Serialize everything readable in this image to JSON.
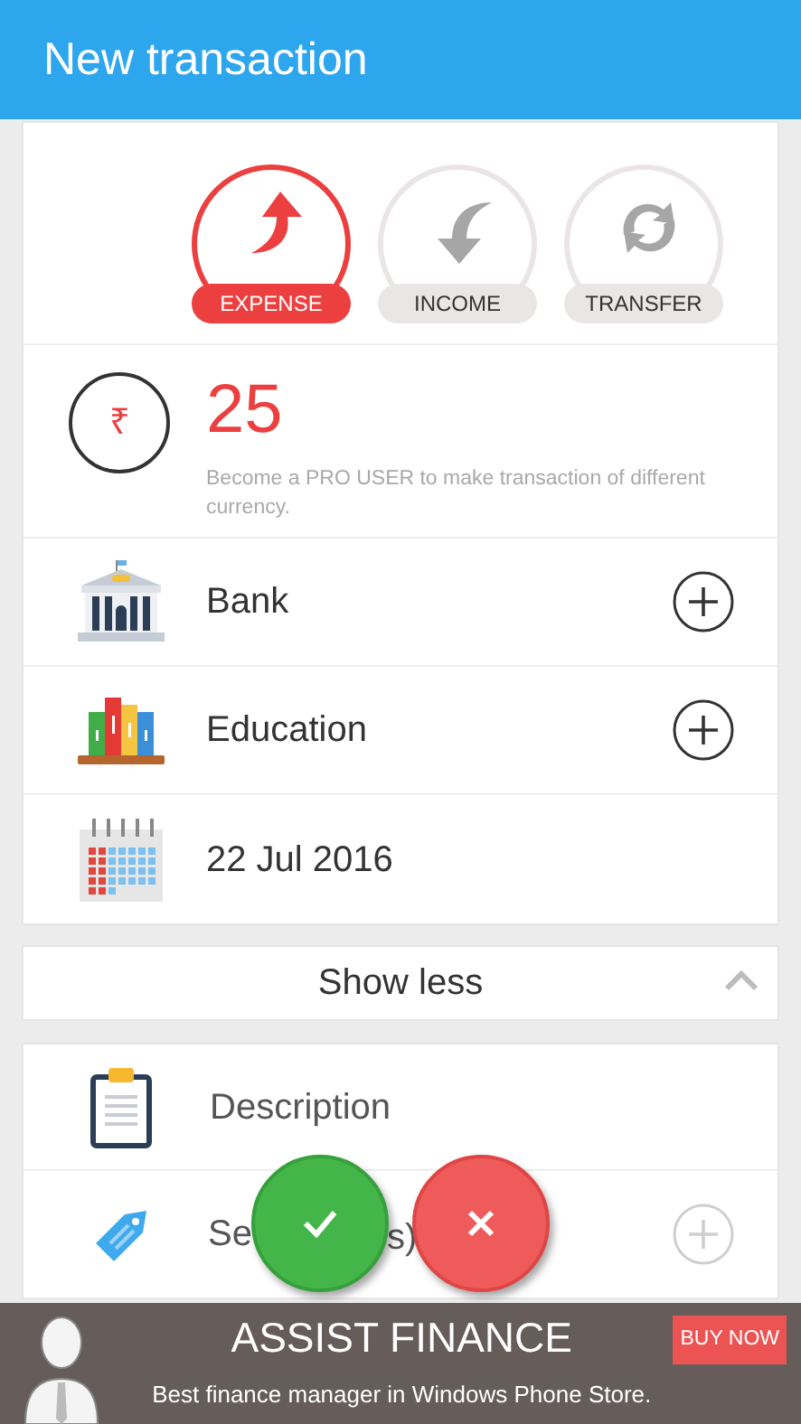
{
  "header": {
    "title": "New transaction"
  },
  "types": [
    {
      "kind": "expense",
      "label": "EXPENSE",
      "selected": true
    },
    {
      "kind": "income",
      "label": "INCOME",
      "selected": false
    },
    {
      "kind": "transfer",
      "label": "TRANSFER",
      "selected": false
    }
  ],
  "amount": {
    "currency_symbol": "₹",
    "value": "25",
    "note": "Become a PRO USER to make transaction of different currency."
  },
  "details": [
    {
      "kind": "bank",
      "label": "Bank",
      "add": true
    },
    {
      "kind": "books",
      "label": "Education",
      "add": true
    },
    {
      "kind": "calendar",
      "label": "22 Jul 2016",
      "add": false
    }
  ],
  "toggle": {
    "label": "Show less",
    "expanded": true
  },
  "description": {
    "placeholder": "Description"
  },
  "tags": {
    "visible_text": [
      "Se",
      "s)"
    ]
  },
  "ad": {
    "title": "ASSIST FINANCE",
    "text": "Best finance manager in Windows Phone Store.",
    "button": "BUY NOW"
  }
}
